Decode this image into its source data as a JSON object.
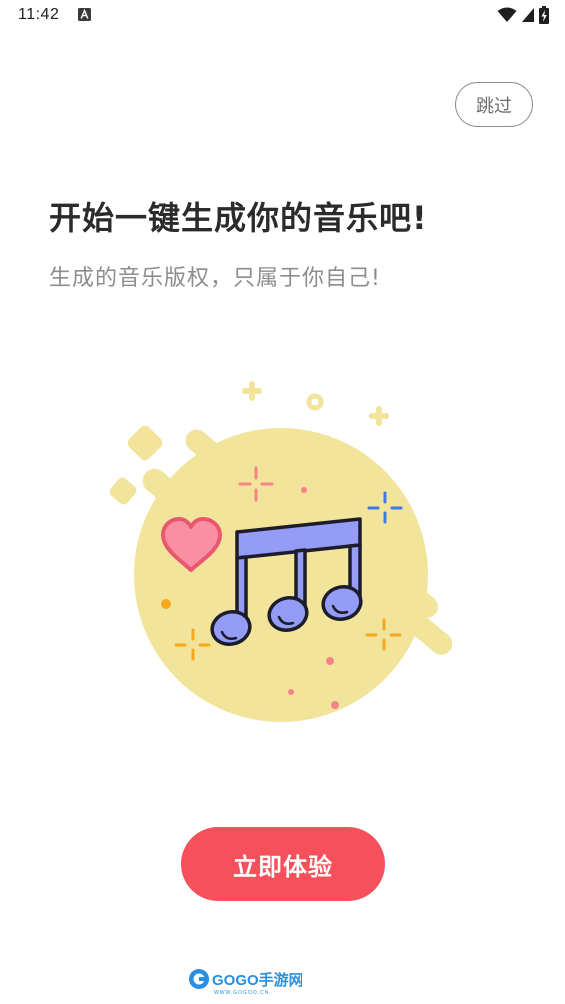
{
  "status_bar": {
    "time": "11:42",
    "icons": [
      "notification-a-icon",
      "wifi-icon",
      "cellular-signal-icon",
      "battery-charging-icon"
    ]
  },
  "skip_label": "跳过",
  "headline": "开始一键生成你的音乐吧!",
  "subtitle": "生成的音乐版权，只属于你自己!",
  "illustration": {
    "icons": [
      "music-note-icon",
      "heart-icon",
      "sparkle-icon"
    ],
    "colors": {
      "blob": "#f2e49a",
      "note": "#949cf5",
      "heart": "#fa8fa3",
      "accent_orange": "#f7a81b",
      "accent_blue": "#3d79ea",
      "accent_pink": "#f6828a"
    }
  },
  "cta_label": "立即体验",
  "watermark": {
    "brand": "GOGO手游网",
    "url": "WWW.GOGOO.CN"
  },
  "colors": {
    "cta_background": "#f5505b",
    "headline": "#2b2b2b",
    "subtitle": "#8d8d8d"
  }
}
